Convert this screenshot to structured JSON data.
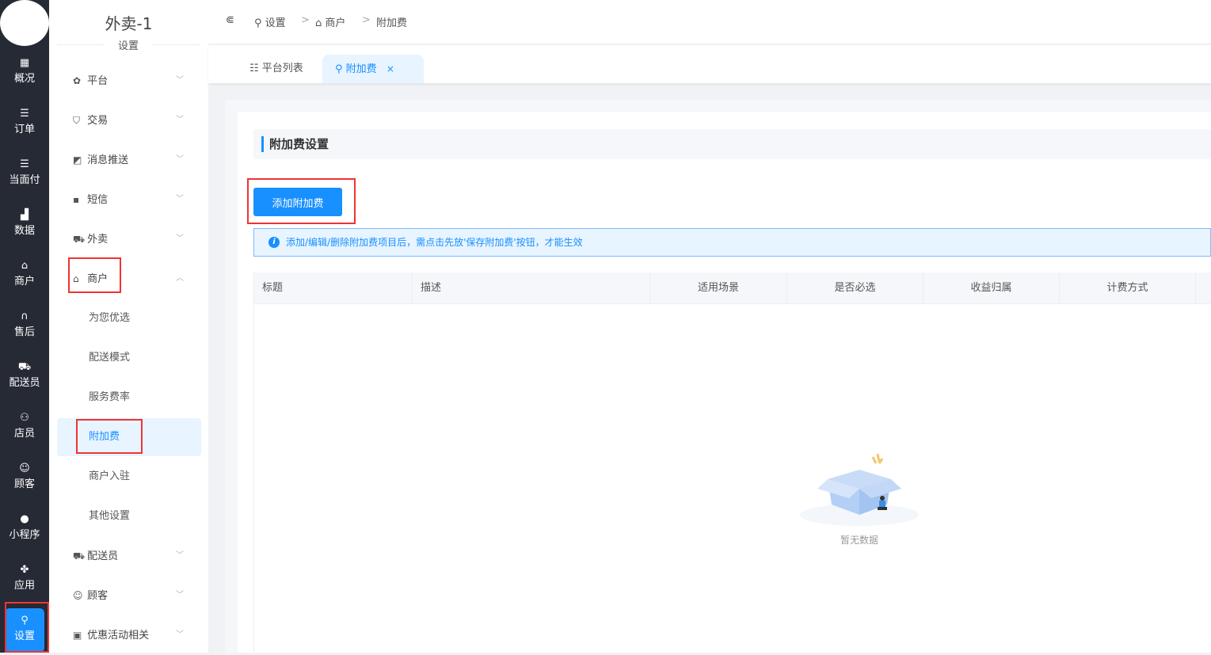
{
  "rail": {
    "items": [
      {
        "icon": "dashboard-icon",
        "glyph": "▦",
        "label": "概况"
      },
      {
        "icon": "list-icon",
        "glyph": "☰",
        "label": "订单"
      },
      {
        "icon": "list-icon",
        "glyph": "☰",
        "label": "当面付"
      },
      {
        "icon": "bar-chart-icon",
        "glyph": "▟",
        "label": "数据"
      },
      {
        "icon": "store-icon",
        "glyph": "⌂",
        "label": "商户"
      },
      {
        "icon": "headset-icon",
        "glyph": "∩",
        "label": "售后"
      },
      {
        "icon": "delivery-icon",
        "glyph": "⛟",
        "label": "配送员"
      },
      {
        "icon": "staff-icon",
        "glyph": "⚇",
        "label": "店员"
      },
      {
        "icon": "customer-icon",
        "glyph": "☺",
        "label": "顾客"
      },
      {
        "icon": "wechat-icon",
        "glyph": "●",
        "label": "小程序"
      },
      {
        "icon": "apps-icon",
        "glyph": "✤",
        "label": "应用"
      },
      {
        "icon": "settings-user-icon",
        "glyph": "⚲",
        "label": "设置"
      }
    ],
    "active": "设置"
  },
  "sub": {
    "title": "外卖-1",
    "subtitle": "设置",
    "menu": [
      {
        "icon": "gear-icon",
        "glyph": "✿",
        "label": "平台",
        "chev": "﹀"
      },
      {
        "icon": "shield-icon",
        "glyph": "⛉",
        "label": "交易",
        "chev": "﹀"
      },
      {
        "icon": "push-icon",
        "glyph": "◩",
        "label": "消息推送",
        "chev": "﹀"
      },
      {
        "icon": "sms-icon",
        "glyph": "▪",
        "label": "短信",
        "chev": "﹀"
      },
      {
        "icon": "delivery-icon",
        "glyph": "⛟",
        "label": "外卖",
        "chev": "﹀"
      },
      {
        "icon": "store-icon",
        "glyph": "⌂",
        "label": "商户",
        "chev": "︿"
      }
    ],
    "children": [
      "为您优选",
      "配送模式",
      "服务费率",
      "附加费",
      "商户入驻",
      "其他设置"
    ],
    "menu2": [
      {
        "icon": "courier-icon",
        "glyph": "⛟",
        "label": "配送员",
        "chev": "﹀"
      },
      {
        "icon": "customer-icon",
        "glyph": "☺",
        "label": "顾客",
        "chev": "﹀"
      },
      {
        "icon": "gift-icon",
        "glyph": "▣",
        "label": "优惠活动相关",
        "chev": "﹀"
      }
    ],
    "selected": "附加费"
  },
  "header": {
    "collapse_glyph": "⋐",
    "breadcrumb": [
      "设置",
      "商户",
      "附加费"
    ],
    "sep": ">"
  },
  "tabs": [
    {
      "label": "平台列表",
      "icon": "list-icon"
    },
    {
      "label": "附加费",
      "icon": "settings-user-icon",
      "close": "×"
    }
  ],
  "main": {
    "section_title": "附加费设置",
    "add_button": "添加附加费",
    "alert": "添加/编辑/删除附加费项目后，需点击先放'保存附加费'按钮，才能生效",
    "columns": [
      "标题",
      "描述",
      "适用场景",
      "是否必选",
      "收益归属",
      "计费方式"
    ],
    "empty": "暂无数据"
  },
  "colors": {
    "accent": "#1890ff",
    "rail": "#262a35",
    "highlight": "#f03333"
  }
}
